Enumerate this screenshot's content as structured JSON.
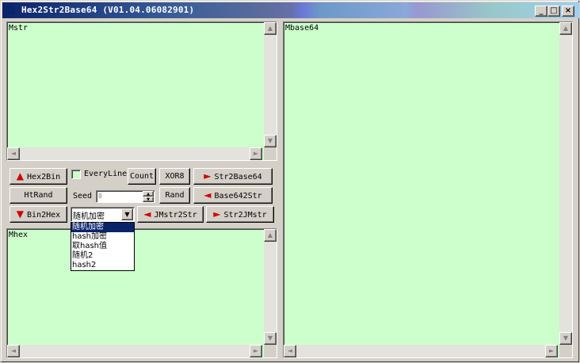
{
  "window": {
    "title": "Hex2Str2Base64 (V01.04.06082901)",
    "controls": {
      "minimize": "_",
      "maximize": "□",
      "close": "×"
    }
  },
  "panes": {
    "mstr": "Mstr",
    "mhex": "Mhex",
    "mbase64": "Mbase64"
  },
  "buttons": {
    "hex2bin": "Hex2Bin",
    "htrand": "HtRand",
    "bin2hex": "Bin2Hex",
    "count": "Count",
    "xor8": "XOR8",
    "rand": "Rand",
    "str2base64": "Str2Base64",
    "base642str": "Base642Str",
    "jmstr2str": "JMstr2Str",
    "str2jmstr": "Str2JMstr"
  },
  "everyline": {
    "label": "EveryLine",
    "checked": false
  },
  "seed": {
    "label": "Seed",
    "value": "0"
  },
  "mode": {
    "selected": "随机加密",
    "options": [
      "随机加密",
      "hash加密",
      "取hash值",
      "随机2",
      "hash2"
    ]
  },
  "icons": {
    "arrow_up": "▲",
    "arrow_down": "▼",
    "arrow_right": "►",
    "arrow_left": "◄",
    "scroll_up": "▲",
    "scroll_down": "▼",
    "scroll_left": "◄",
    "scroll_right": "►",
    "dropdown": "▼"
  },
  "colors": {
    "text_area_bg": "#ccffcc",
    "arrow": "#d00000",
    "selection": "#0a246a"
  }
}
